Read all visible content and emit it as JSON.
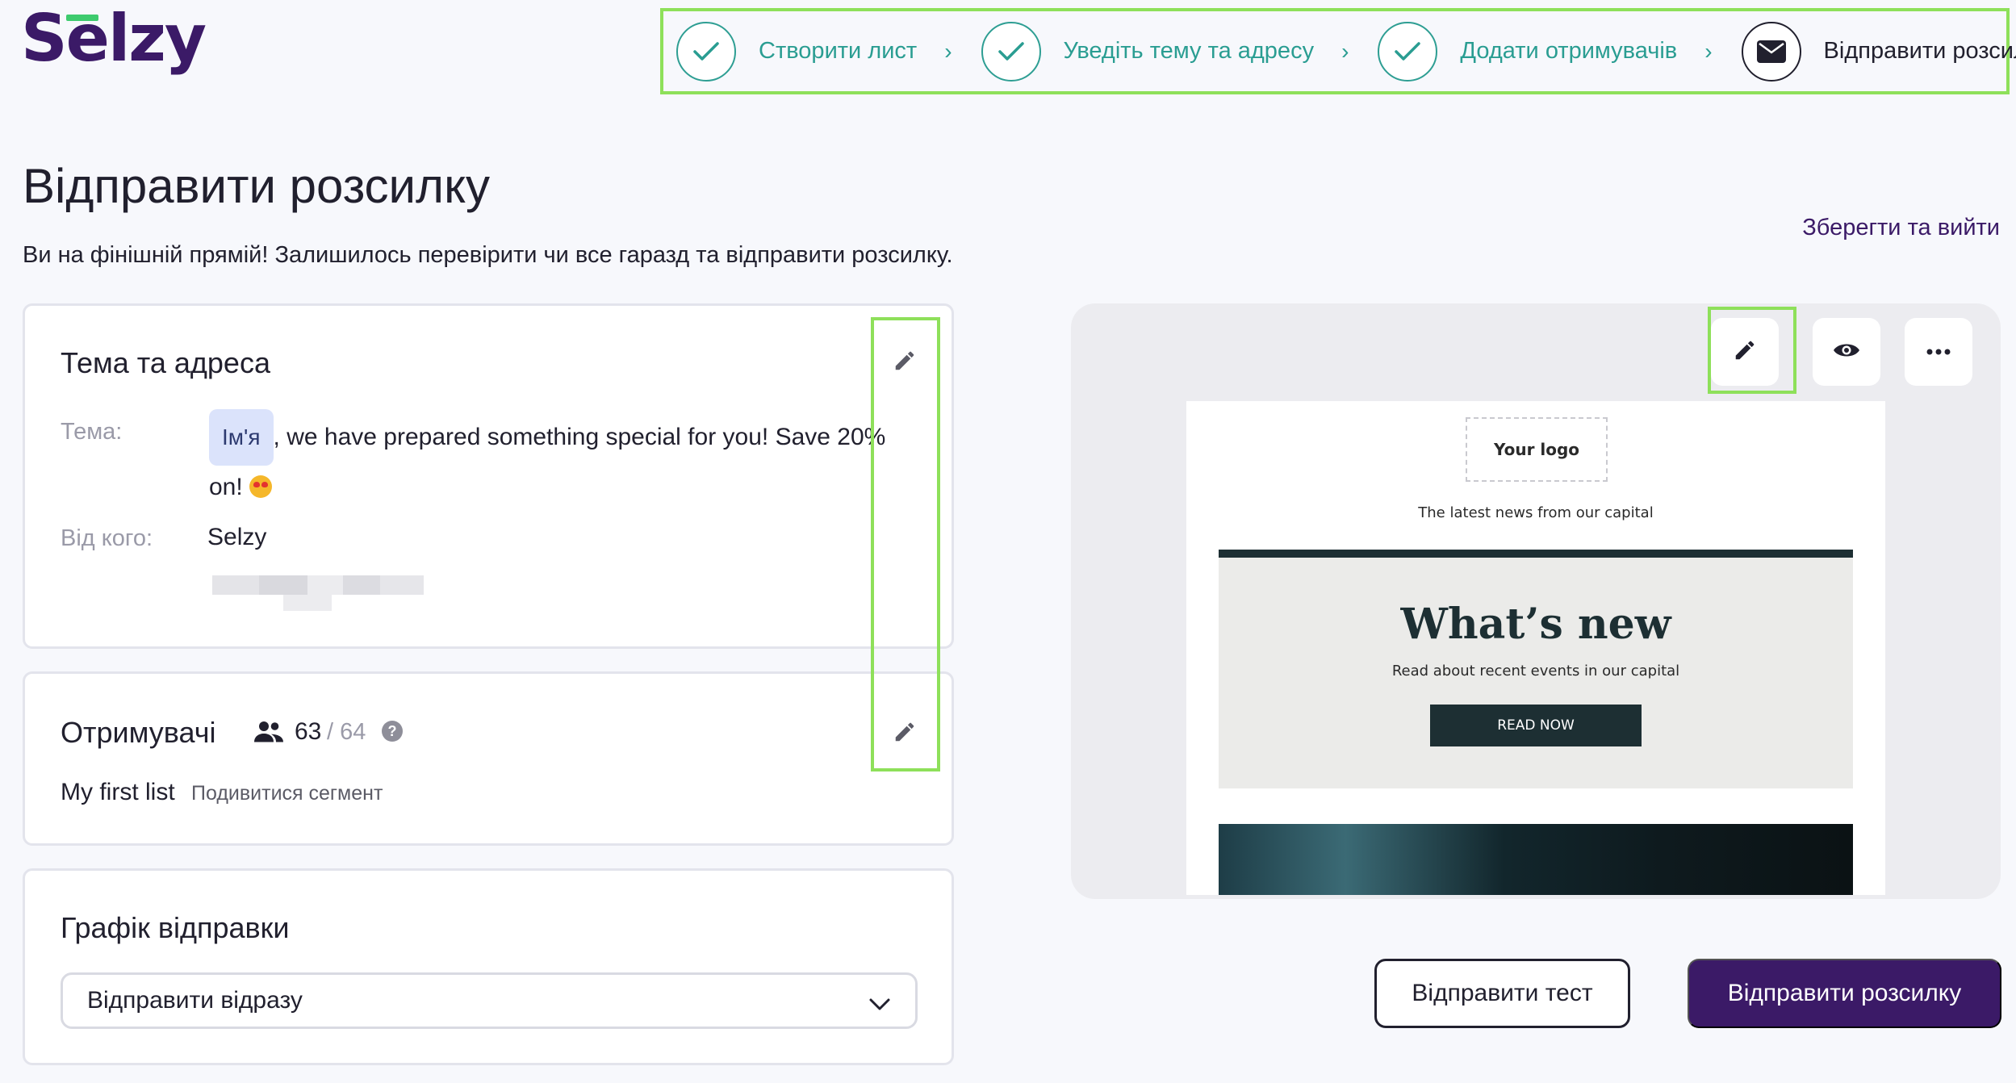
{
  "brand": {
    "logo_text": "Selzy"
  },
  "stepper": {
    "steps": [
      {
        "label": "Створити лист",
        "state": "done"
      },
      {
        "label": "Уведіть тему та адресу",
        "state": "done"
      },
      {
        "label": "Додати отримувачів",
        "state": "done"
      },
      {
        "label": "Відправити розсилку",
        "state": "current"
      }
    ]
  },
  "page": {
    "title": "Відправити розсилку",
    "subtitle": "Ви на фінішній прямій! Залишилось перевірити чи все гаразд та відправити розсилку.",
    "save_exit": "Зберегти та вийти"
  },
  "subject_card": {
    "title": "Тема та адреса",
    "subject_label": "Тема:",
    "name_tag": "Ім'я",
    "subject_text": ", we have prepared something special for you! Save 20%",
    "subject_text_2": "on!",
    "from_label": "Від кого:",
    "from_value": "Selzy"
  },
  "recipients_card": {
    "title": "Отримувачі",
    "count": "63",
    "total": "/ 64",
    "list_name": "My first list",
    "segment_link": "Подивитися сегмент"
  },
  "schedule_card": {
    "title": "Графік відправки",
    "selected": "Відправити відразу"
  },
  "preview": {
    "logo_placeholder": "Your logo",
    "tagline": "The latest news from our capital",
    "hero_title": "What’s new",
    "hero_subtitle": "Read about recent events in our capital",
    "hero_button": "READ NOW"
  },
  "actions": {
    "send_test": "Відправити тест",
    "send": "Відправити розсилку"
  },
  "colors": {
    "brand_purple": "#3b1a67",
    "step_teal": "#2a9d92",
    "highlight_green": "#8ee05a"
  }
}
